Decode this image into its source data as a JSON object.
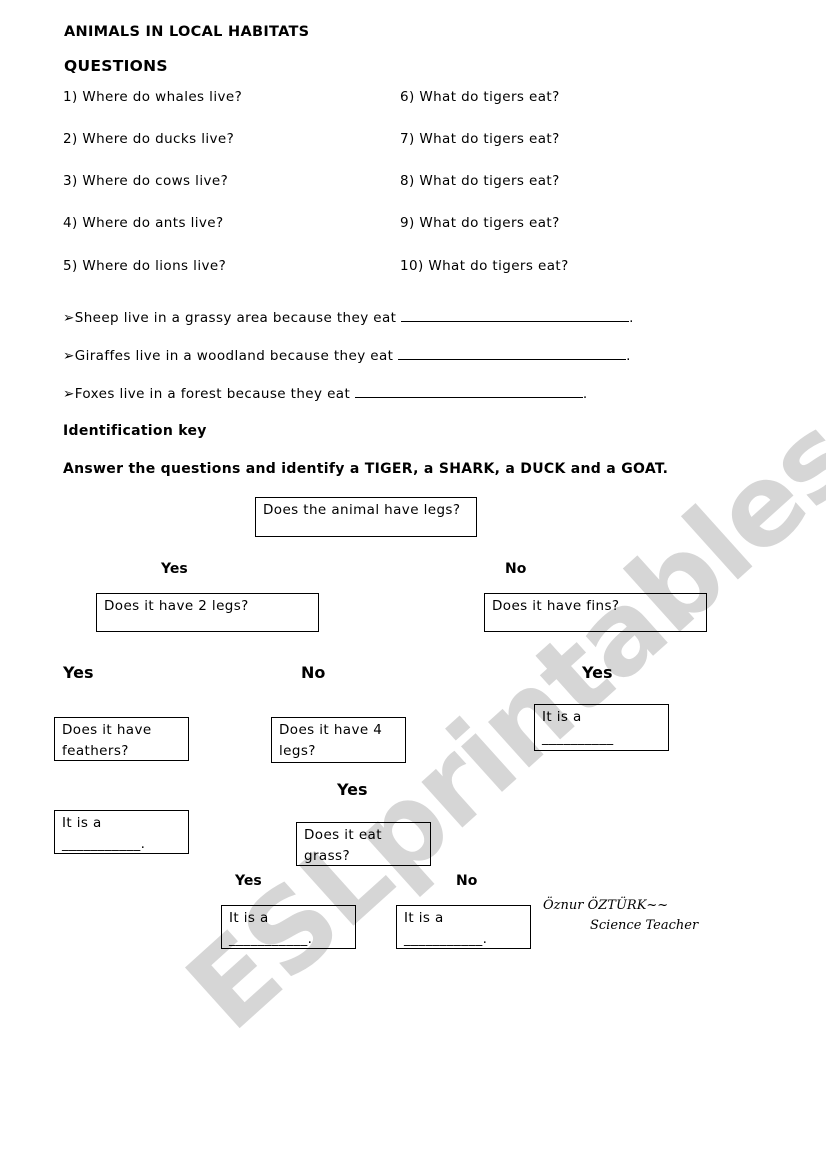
{
  "header": {
    "title": "ANIMALS IN LOCAL HABITATS",
    "subtitle": "QUESTIONS"
  },
  "questions_left": [
    "1)  Where do whales live?",
    "2)  Where do ducks live?",
    "3)  Where do cows  live?",
    "4)  Where do ants  live?",
    "5)  Where do lions live?"
  ],
  "questions_right": [
    "6)  What do tigers eat?",
    "7)  What do tigers eat?",
    "8)  What do tigers eat?",
    "9)  What do tigers eat?",
    "10) What do tigers eat?"
  ],
  "fill_in": {
    "bullet": "➢",
    "items": [
      {
        "text": "Sheep live in a grassy area because they eat",
        "end": "."
      },
      {
        "text": "Giraffes live in a woodland because they eat",
        "end": "."
      },
      {
        "text": "Foxes live in a forest because they eat",
        "end": "."
      }
    ]
  },
  "key": {
    "heading": "Identification key",
    "instruction": "Answer the questions and identify a TIGER, a SHARK, a DUCK and a GOAT.",
    "nodes": {
      "root": "Does the animal have legs?",
      "two_legs": "Does it have 2 legs?",
      "fins": "Does it have fins?",
      "feathers": "Does it have feathers?",
      "four_legs": "Does it have 4 legs?",
      "eat_grass": "Does it eat grass?",
      "answer_prefix": "It is a",
      "answer_blank": "__________",
      "answer_blank_dot": "___________."
    },
    "labels": {
      "yes": "Yes",
      "no": "No"
    }
  },
  "signature": {
    "name": "Öznur ÖZTÜRK~~",
    "role": "Science Teacher"
  },
  "watermark": "ESLprintables.com"
}
